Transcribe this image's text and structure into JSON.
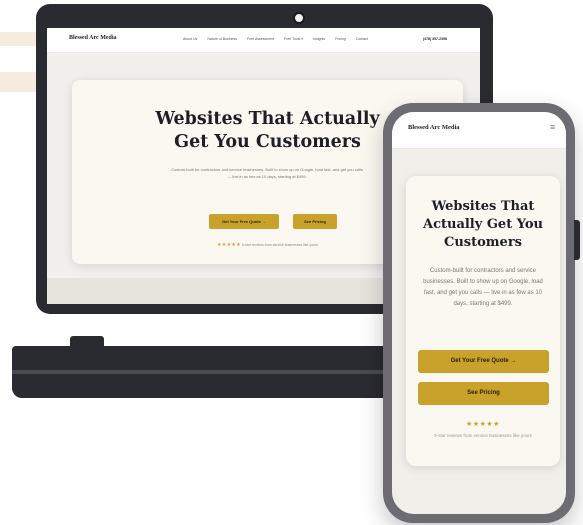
{
  "brand": "Blessed Arc Media",
  "laptop": {
    "nav_links": [
      "About Us",
      "Nature of Business",
      "Free Assessment",
      "Free Tools ▾",
      "Insights",
      "Pricing",
      "Contact"
    ],
    "phone": "(478) 397-2398",
    "hero_title_line1": "Websites That Actually",
    "hero_title_line2_pre": "Get You ",
    "hero_title_line2_hl": "Customers",
    "hero_subtitle": "Custom-built for contractors and service businesses. Built to show up on Google, load fast, and get you calls — live in as few as 10 days, starting at $499.",
    "cta_primary": "Get Your Free Quote →",
    "cta_secondary": "See Pricing",
    "stars": "★★★★★",
    "rating_text": "5-star reviews from service businesses like yours"
  },
  "phone": {
    "menu_icon": "≡",
    "hero_title_line1": "Websites That",
    "hero_title_line2": "Actually Get You",
    "hero_title_line3": "Customers",
    "hero_subtitle": "Custom-built for contractors and service businesses. Built to show up on Google, load fast, and get you calls — live in as few as 10 days, starting at $499.",
    "cta_primary": "Get Your Free Quote →",
    "cta_secondary": "See Pricing",
    "stars": "★★★★★",
    "rating_text": "5-star reviews from service businesses like yours"
  },
  "colors": {
    "accent_gold": "#c9a22c",
    "device_frame": "#2a2a31",
    "hero_bg": "#fbf8f1"
  }
}
